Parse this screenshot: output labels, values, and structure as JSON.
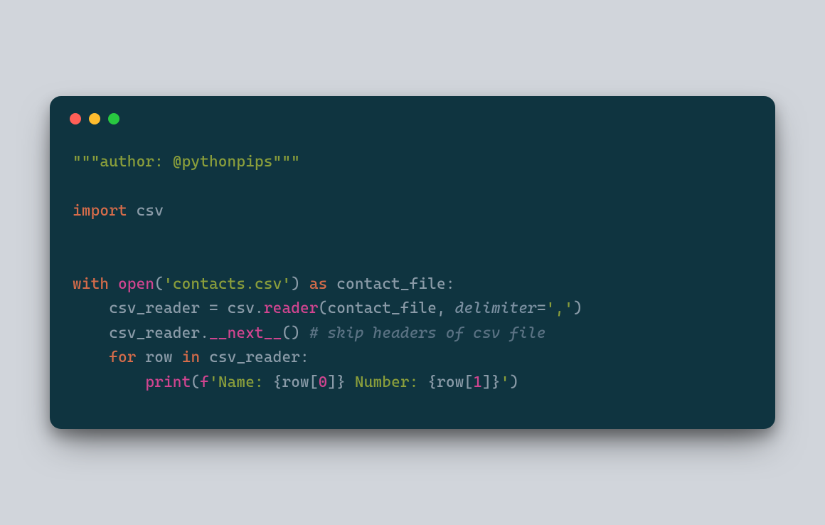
{
  "titlebar": {
    "buttons": {
      "close": "close",
      "minimize": "minimize",
      "maximize": "maximize"
    }
  },
  "code": {
    "line1": {
      "docstring": "\"\"\"author: @pythonpips\"\"\""
    },
    "line3": {
      "import_kw": "import",
      "module": " csv"
    },
    "line6": {
      "with_kw": "with",
      "space1": " ",
      "open_fn": "open",
      "paren_open": "(",
      "file_str": "'contacts.csv'",
      "paren_close": ")",
      "space2": " ",
      "as_kw": "as",
      "space3": " ",
      "var": "contact_file",
      "colon": ":"
    },
    "line7": {
      "indent": "    ",
      "var": "csv_reader",
      "space1": " ",
      "eq": "=",
      "space2": " ",
      "module": "csv",
      "dot": ".",
      "method": "reader",
      "paren_open": "(",
      "arg1": "contact_file",
      "comma": ",",
      "space3": " ",
      "kwarg": "delimiter",
      "eq2": "=",
      "delim_str": "','",
      "paren_close": ")"
    },
    "line8": {
      "indent": "    ",
      "var": "csv_reader",
      "dot": ".",
      "dunder": "__next__",
      "parens": "()",
      "space": " ",
      "comment": "# skip headers of csv file"
    },
    "line9": {
      "indent": "    ",
      "for_kw": "for",
      "space1": " ",
      "var": "row",
      "space2": " ",
      "in_kw": "in",
      "space3": " ",
      "iter": "csv_reader",
      "colon": ":"
    },
    "line10": {
      "indent": "        ",
      "print_fn": "print",
      "paren_open": "(",
      "f_prefix": "f",
      "str_open": "'",
      "text1": "Name: ",
      "brace_open1": "{",
      "expr1_var": "row",
      "expr1_bracket_open": "[",
      "expr1_idx": "0",
      "expr1_bracket_close": "]",
      "brace_close1": "}",
      "text2": " Number: ",
      "brace_open2": "{",
      "expr2_var": "row",
      "expr2_bracket_open": "[",
      "expr2_idx": "1",
      "expr2_bracket_close": "]",
      "brace_close2": "}",
      "str_close": "'",
      "paren_close": ")"
    }
  }
}
